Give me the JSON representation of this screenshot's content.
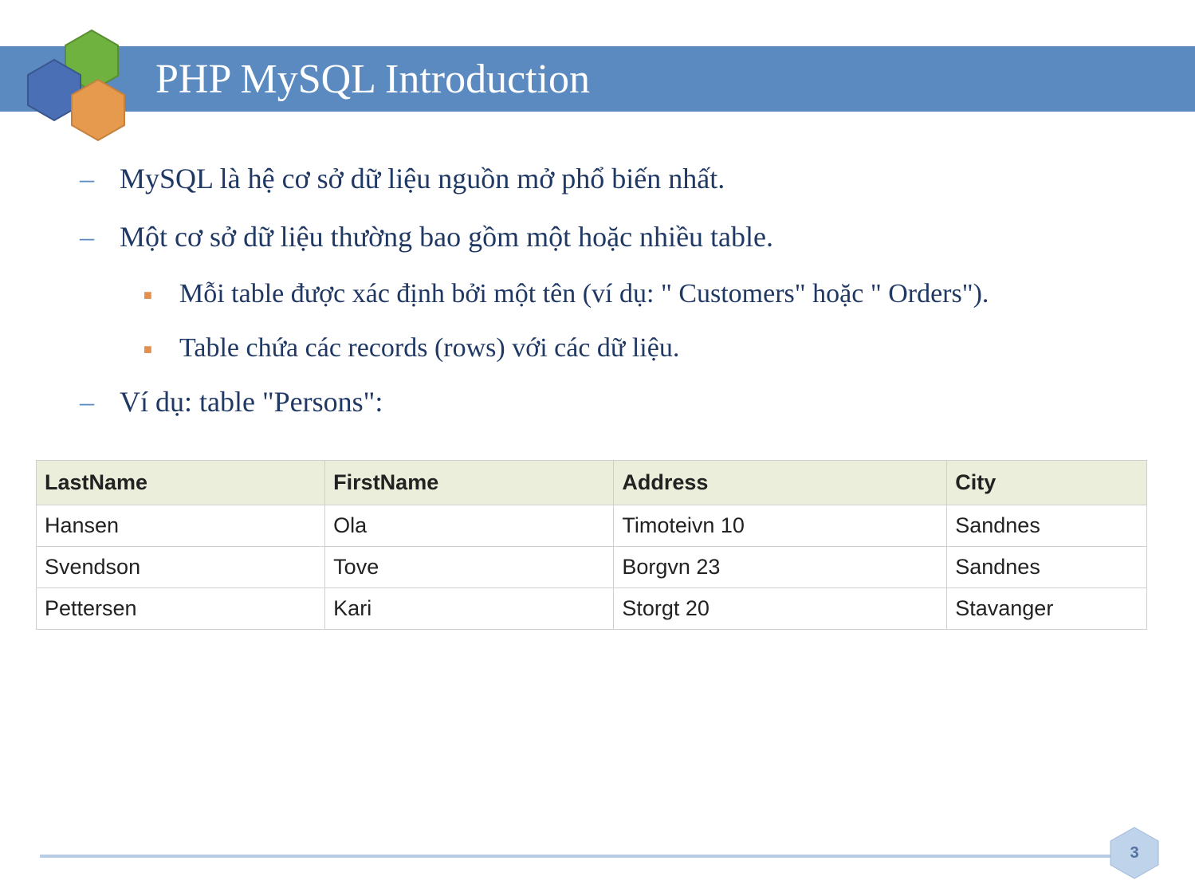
{
  "header": {
    "title": "PHP MySQL Introduction"
  },
  "bullets": {
    "b1": "MySQL là hệ cơ sở dữ liệu nguồn mở phổ biến nhất.",
    "b2": "Một cơ sở dữ liệu thường bao gồm một hoặc nhiều table.",
    "b2a": "Mỗi table được xác định bởi một tên (ví dụ: \" Customers\" hoặc \" Orders\").",
    "b2b": "Table chứa các records (rows) với các dữ liệu.",
    "b3": "Ví dụ: table \"Persons\":"
  },
  "table": {
    "headers": [
      "LastName",
      "FirstName",
      "Address",
      "City"
    ],
    "rows": [
      [
        "Hansen",
        "Ola",
        "Timoteivn 10",
        "Sandnes"
      ],
      [
        "Svendson",
        "Tove",
        "Borgvn 23",
        "Sandnes"
      ],
      [
        "Pettersen",
        "Kari",
        "Storgt 20",
        "Stavanger"
      ]
    ]
  },
  "page": {
    "number": "3"
  }
}
